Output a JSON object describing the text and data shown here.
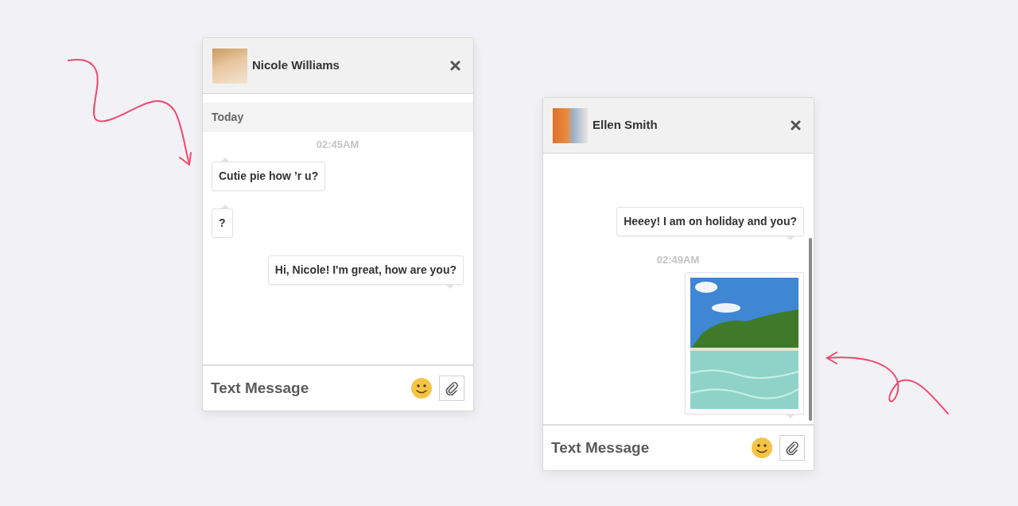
{
  "chats": [
    {
      "contact": "Nicole Williams",
      "day_label": "Today",
      "messages": [
        {
          "kind": "time",
          "text": "02:45AM"
        },
        {
          "kind": "text",
          "outgoing": false,
          "text": "Cutie pie how ’r u?"
        },
        {
          "kind": "text",
          "outgoing": false,
          "text": "?"
        },
        {
          "kind": "text",
          "outgoing": true,
          "text": "Hi, Nicole! I'm great, how are you?"
        }
      ],
      "composer": {
        "placeholder": "Text Message"
      }
    },
    {
      "contact": "Ellen Smith",
      "messages": [
        {
          "kind": "text",
          "outgoing": true,
          "text": "Heeey! I am on holiday and you?"
        },
        {
          "kind": "time",
          "text": "02:49AM"
        },
        {
          "kind": "image",
          "outgoing": true
        }
      ],
      "composer": {
        "placeholder": "Text Message"
      }
    }
  ]
}
